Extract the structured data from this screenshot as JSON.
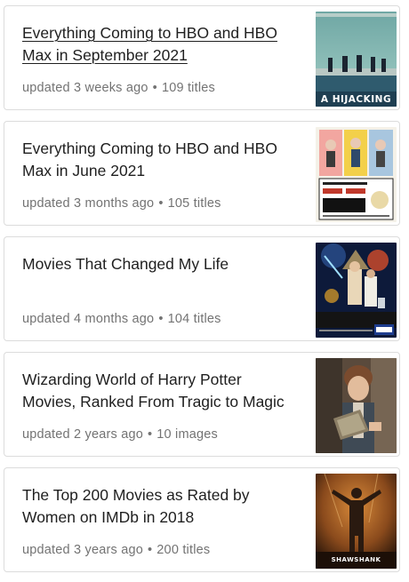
{
  "lists": [
    {
      "title": "Everything Coming to HBO and HBO Max in September 2021",
      "updated": "updated 3 weeks ago",
      "count": "109 titles",
      "thumbnail_icon": "a-hijacking-poster",
      "thumbnail_text": "A HIJACKING"
    },
    {
      "title": "Everything Coming to HBO and HBO Max in June 2021",
      "updated": "updated 3 months ago",
      "count": "105 titles",
      "thumbnail_icon": "vintage-film-poster"
    },
    {
      "title": "Movies That Changed My Life",
      "updated": "updated 4 months ago",
      "count": "104 titles",
      "thumbnail_icon": "star-wars-poster"
    },
    {
      "title": "Wizarding World of Harry Potter Movies, Ranked From Tragic to Magic",
      "updated": "updated 2 years ago",
      "count": "10 images",
      "thumbnail_icon": "fantastic-beasts-still"
    },
    {
      "title": "The Top 200 Movies as Rated by Women on IMDb in 2018",
      "updated": "updated 3 years ago",
      "count": "200 titles",
      "thumbnail_icon": "shawshank-redemption-poster",
      "thumbnail_text": "SHAWSHANK"
    }
  ],
  "separator": "•"
}
